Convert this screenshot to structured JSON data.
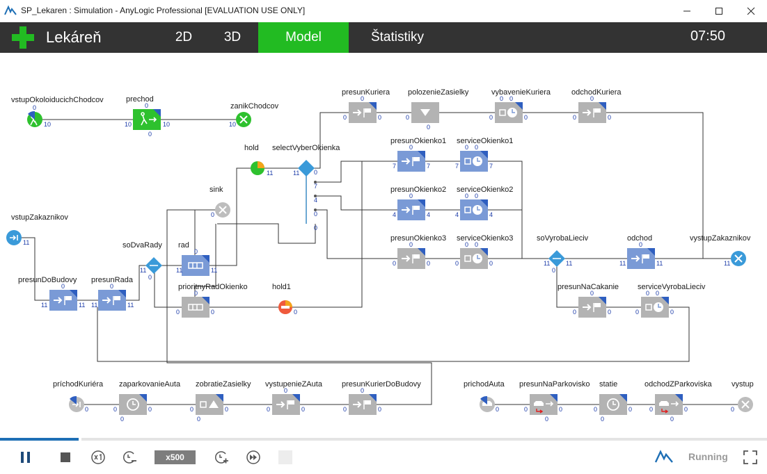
{
  "window": {
    "title": "SP_Lekaren : Simulation - AnyLogic Professional [EVALUATION USE ONLY]"
  },
  "header": {
    "app_name": "Lekáreň",
    "tabs": [
      {
        "label": "2D",
        "active": false
      },
      {
        "label": "3D",
        "active": false
      },
      {
        "label": "Model",
        "active": true
      },
      {
        "label": "Štatistiky",
        "active": false
      }
    ],
    "clock": "07:50"
  },
  "colors": {
    "accent_green": "#22bb22",
    "header_bg": "#333333",
    "block_blue": "#7a9ad6",
    "block_gray": "#b3b3b3",
    "progress_blue": "#1e6fb5"
  },
  "model": {
    "blocks": [
      {
        "id": "vstupOkoloiducichChodcov",
        "label": "vstupOkoloiducichChodcov",
        "icon": "source-pedestrian-icon",
        "counts": [
          "0",
          "10"
        ]
      },
      {
        "id": "prechod",
        "label": "prechod",
        "icon": "exit-pedestrian-icon",
        "counts": [
          "0",
          "10",
          "10",
          "0"
        ]
      },
      {
        "id": "zanikChodcov",
        "label": "zanikChodcov",
        "icon": "sink-icon",
        "counts": [
          "10"
        ]
      },
      {
        "id": "hold",
        "label": "hold",
        "icon": "hold-icon",
        "counts": [
          "11"
        ]
      },
      {
        "id": "selectVyberOkienka",
        "label": "selectVyberOkienka",
        "icon": "select-output-icon",
        "counts": [
          "11",
          "0",
          "7",
          "4",
          "0",
          "0"
        ]
      },
      {
        "id": "sink",
        "label": "sink",
        "icon": "sink-icon",
        "counts": [
          "0"
        ]
      },
      {
        "id": "vstupZakaznikov",
        "label": "vstupZakaznikov",
        "icon": "source-icon",
        "counts": [
          "11"
        ]
      },
      {
        "id": "soDvaRady",
        "label": "soDvaRady",
        "icon": "select-output-icon",
        "counts": [
          "11",
          "0"
        ]
      },
      {
        "id": "rad",
        "label": "rad",
        "icon": "queue-icon",
        "counts": [
          "0",
          "11",
          "11"
        ]
      },
      {
        "id": "presunDoBudovy",
        "label": "presunDoBudovy",
        "icon": "move-to-icon",
        "counts": [
          "0",
          "11",
          "11"
        ]
      },
      {
        "id": "presunRada",
        "label": "presunRada",
        "icon": "move-to-icon",
        "counts": [
          "0",
          "11",
          "11"
        ]
      },
      {
        "id": "prioritnyRadOkienko",
        "label": "prioritnyRadOkienko",
        "icon": "queue-icon",
        "counts": [
          "0",
          "0",
          "0"
        ]
      },
      {
        "id": "hold1",
        "label": "hold1",
        "icon": "hold-blocked-icon",
        "counts": [
          "0"
        ]
      },
      {
        "id": "presunKuriera",
        "label": "presunKuriera",
        "icon": "move-to-icon",
        "counts": [
          "0",
          "0",
          "0"
        ]
      },
      {
        "id": "polozenieZasielky",
        "label": "polozenieZasielky",
        "icon": "drop-off-icon",
        "counts": [
          "0",
          "0"
        ]
      },
      {
        "id": "vybavenieKuriera",
        "label": "vybavenieKuriera",
        "icon": "service-icon",
        "counts": [
          "0",
          "0",
          "0",
          "0"
        ]
      },
      {
        "id": "odchodKuriera",
        "label": "odchodKuriera",
        "icon": "move-to-icon",
        "counts": [
          "0",
          "0",
          "0"
        ]
      },
      {
        "id": "presunOkienko1",
        "label": "presunOkienko1",
        "icon": "move-to-icon",
        "counts": [
          "0",
          "7",
          "7"
        ]
      },
      {
        "id": "serviceOkienko1",
        "label": "serviceOkienko1",
        "icon": "service-icon",
        "counts": [
          "0",
          "0",
          "7",
          "7"
        ]
      },
      {
        "id": "presunOkienko2",
        "label": "presunOkienko2",
        "icon": "move-to-icon",
        "counts": [
          "0",
          "4",
          "4"
        ]
      },
      {
        "id": "serviceOkienko2",
        "label": "serviceOkienko2",
        "icon": "service-icon",
        "counts": [
          "0",
          "0",
          "4",
          "4"
        ]
      },
      {
        "id": "presunOkienko3",
        "label": "presunOkienko3",
        "icon": "move-to-icon",
        "counts": [
          "0",
          "0",
          "0"
        ]
      },
      {
        "id": "serviceOkienko3",
        "label": "serviceOkienko3",
        "icon": "service-icon",
        "counts": [
          "0",
          "0",
          "0",
          "0"
        ]
      },
      {
        "id": "soVyrobaLieciv",
        "label": "soVyrobaLieciv",
        "icon": "select-output-icon",
        "counts": [
          "11",
          "11",
          "0"
        ]
      },
      {
        "id": "odchod",
        "label": "odchod",
        "icon": "move-to-icon",
        "counts": [
          "0",
          "11",
          "11"
        ]
      },
      {
        "id": "vystupZakaznikov",
        "label": "vystupZakaznikov",
        "icon": "sink-icon",
        "counts": [
          "11"
        ]
      },
      {
        "id": "presunNaCakanie",
        "label": "presunNaCakanie",
        "icon": "move-to-icon",
        "counts": [
          "0",
          "0",
          "0"
        ]
      },
      {
        "id": "serviceVyrobaLieciv",
        "label": "serviceVyrobaLieciv",
        "icon": "service-icon",
        "counts": [
          "0",
          "0",
          "0",
          "0"
        ]
      },
      {
        "id": "prichodKuriera",
        "label": "príchodKuriéra",
        "icon": "source-icon",
        "counts": [
          "0"
        ]
      },
      {
        "id": "zaparkovanieAuta",
        "label": "zaparkovanieAuta",
        "icon": "delay-icon",
        "counts": [
          "0",
          "0",
          "0"
        ]
      },
      {
        "id": "zobratieZasielky",
        "label": "zobratieZasielky",
        "icon": "pickup-icon",
        "counts": [
          "0",
          "0",
          "0"
        ]
      },
      {
        "id": "vystupenieZAuta",
        "label": "vystupenieZAuta",
        "icon": "move-to-icon",
        "counts": [
          "0",
          "0",
          "0"
        ]
      },
      {
        "id": "presunKurierDoBudovy",
        "label": "presunKurierDoBudovy",
        "icon": "move-to-icon",
        "counts": [
          "0",
          "0",
          "0"
        ]
      },
      {
        "id": "prichodAuta",
        "label": "prichodAuta",
        "icon": "car-source-icon",
        "counts": [
          "0"
        ]
      },
      {
        "id": "presunNaParkovisko",
        "label": "presunNaParkovisko",
        "icon": "car-move-to-icon",
        "counts": [
          "0",
          "0",
          "0"
        ]
      },
      {
        "id": "statie",
        "label": "statie",
        "icon": "delay-icon",
        "counts": [
          "0",
          "0",
          "0"
        ]
      },
      {
        "id": "odchodZParkoviska",
        "label": "odchodZParkoviska",
        "icon": "car-move-to-icon",
        "counts": [
          "0",
          "0",
          "0"
        ]
      },
      {
        "id": "vystup",
        "label": "vystup",
        "icon": "sink-icon",
        "counts": [
          "0"
        ]
      }
    ]
  },
  "controls": {
    "speed": "x500",
    "status": "Running",
    "progress_fraction": 0.103
  }
}
